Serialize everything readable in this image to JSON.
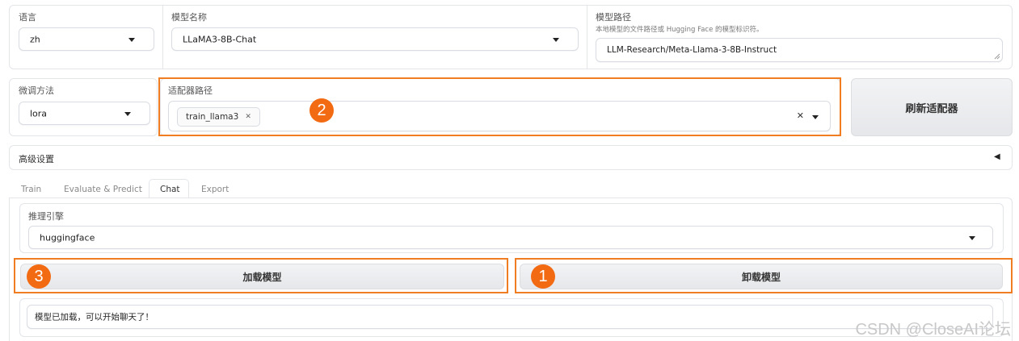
{
  "row1": {
    "language_label": "语言",
    "language_value": "zh",
    "model_name_label": "模型名称",
    "model_name_value": "LLaMA3-8B-Chat",
    "model_path_label": "模型路径",
    "model_path_hint": "本地模型的文件路径或 Hugging Face 的模型标识符。",
    "model_path_value": "LLM-Research/Meta-Llama-3-8B-Instruct"
  },
  "row2": {
    "finetune_label": "微调方法",
    "finetune_value": "lora",
    "adapter_label": "适配器路径",
    "adapter_chip": "train_llama3",
    "refresh_button": "刷新适配器"
  },
  "advanced": {
    "label": "高级设置",
    "toggle": "◀"
  },
  "tabs": [
    {
      "label": "Train"
    },
    {
      "label": "Evaluate & Predict"
    },
    {
      "label": "Chat"
    },
    {
      "label": "Export"
    }
  ],
  "chat": {
    "engine_label": "推理引擎",
    "engine_value": "huggingface",
    "load_button": "加载模型",
    "unload_button": "卸载模型",
    "status_text": "模型已加载，可以开始聊天了！"
  },
  "badges": {
    "one": "1",
    "two": "2",
    "three": "3"
  },
  "watermark": "CSDN @CloseAI论坛",
  "colors": {
    "highlight": "#f07d22",
    "badge": "#f26a12"
  }
}
